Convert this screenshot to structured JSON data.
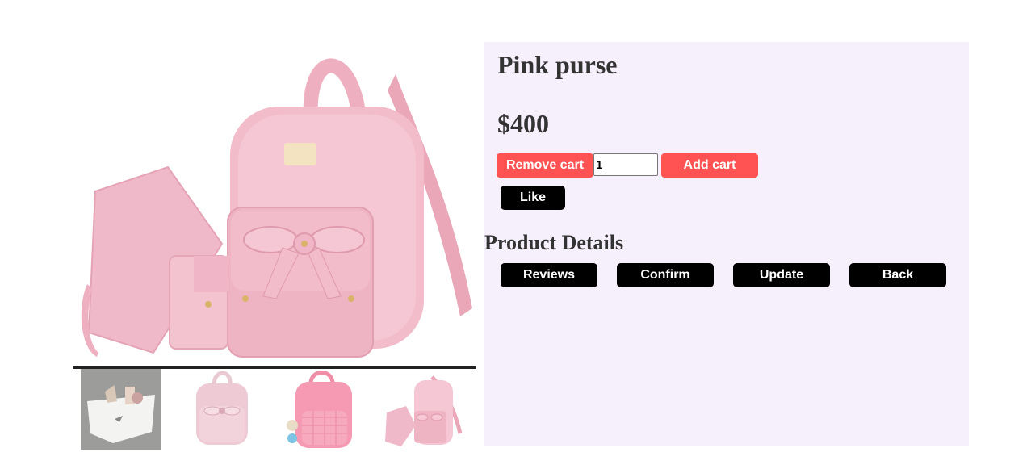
{
  "product": {
    "name": "Pink purse",
    "price": "$400",
    "quantity": "1"
  },
  "actions": {
    "remove_cart": "Remove cart",
    "add_cart": "Add cart",
    "like": "Like"
  },
  "details": {
    "heading": "Product Details",
    "buttons": [
      "Reviews",
      "Confirm",
      "Update",
      "Back"
    ]
  },
  "gallery": {
    "main": "pink-backpack-set",
    "thumbnails": [
      "white-purse",
      "pink-bow-backpack",
      "pink-quilted-backpack",
      "pink-backpack-set"
    ]
  },
  "colors": {
    "panel_bg": "#f6f0fc",
    "red_button": "#ff5252",
    "black_button": "#000000",
    "text": "#333333",
    "product_pink": "#efb4c4"
  }
}
